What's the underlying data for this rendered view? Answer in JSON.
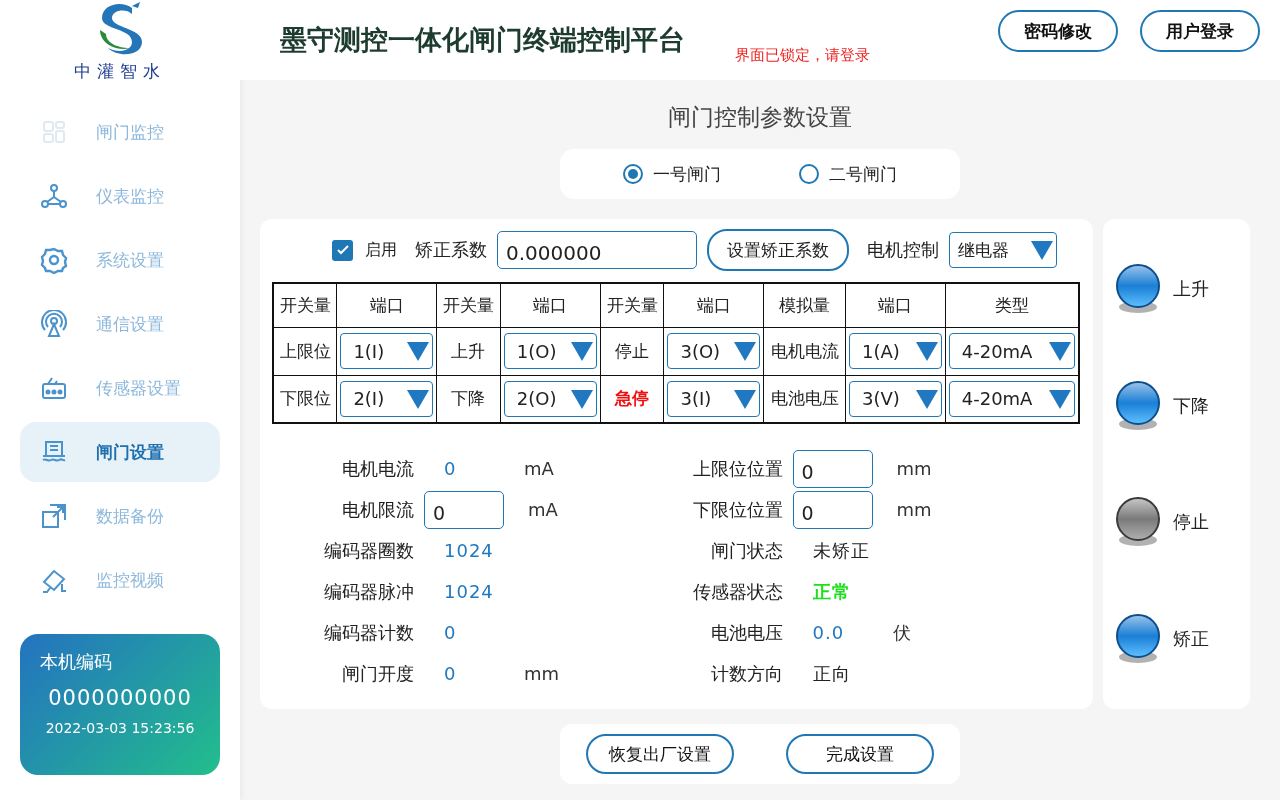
{
  "logo": {
    "text": "中灌智水"
  },
  "sidebar": {
    "items": [
      {
        "label": "闸门监控",
        "selected": false
      },
      {
        "label": "仪表监控",
        "selected": false
      },
      {
        "label": "系统设置",
        "selected": false
      },
      {
        "label": "通信设置",
        "selected": false
      },
      {
        "label": "传感器设置",
        "selected": false
      },
      {
        "label": "闸门设置",
        "selected": true
      },
      {
        "label": "数据备份",
        "selected": false
      },
      {
        "label": "监控视频",
        "selected": false
      }
    ],
    "device_card": {
      "title": "本机编码",
      "code": "0000000000",
      "datetime": "2022-03-03 15:23:56"
    }
  },
  "header": {
    "title": "墨守测控一体化闸门终端控制平台",
    "notice": "界面已锁定，请登录",
    "buttons": [
      "密码修改",
      "用户登录"
    ]
  },
  "page_title": "闸门控制参数设置",
  "gates": [
    {
      "label": "一号闸门",
      "selected": true
    },
    {
      "label": "二号闸门",
      "selected": false
    }
  ],
  "toolbar": {
    "enable": {
      "label": "启用",
      "checked": true
    },
    "coef_label": "矫正系数",
    "coef_value": "0.000000",
    "set_button": "设置矫正系数",
    "motor_label": "电机控制",
    "motor_value": "继电器"
  },
  "table": {
    "columns": [
      "开关量",
      "端口",
      "开关量",
      "端口",
      "开关量",
      "端口",
      "模拟量",
      "端口",
      "类型"
    ],
    "rows": [
      [
        {
          "kind": "label",
          "text": "上限位"
        },
        {
          "kind": "select",
          "value": "1(I)"
        },
        {
          "kind": "label",
          "text": "上升"
        },
        {
          "kind": "select",
          "value": "1(O)"
        },
        {
          "kind": "label",
          "text": "停止"
        },
        {
          "kind": "select",
          "value": "3(O)"
        },
        {
          "kind": "label",
          "text": "电机电流"
        },
        {
          "kind": "select",
          "value": "1(A)"
        },
        {
          "kind": "select",
          "value": "4-20mA"
        }
      ],
      [
        {
          "kind": "label",
          "text": "下限位"
        },
        {
          "kind": "select",
          "value": "2(I)"
        },
        {
          "kind": "label",
          "text": "下降"
        },
        {
          "kind": "select",
          "value": "2(O)"
        },
        {
          "kind": "alarm",
          "text": "急停"
        },
        {
          "kind": "select",
          "value": "3(I)"
        },
        {
          "kind": "label",
          "text": "电池电压"
        },
        {
          "kind": "select",
          "value": "3(V)"
        },
        {
          "kind": "select",
          "value": "4-20mA"
        }
      ]
    ]
  },
  "info_left": [
    {
      "label": "电机电流",
      "kind": "value",
      "value": "0",
      "color": "#1f78c0",
      "unit": "mA"
    },
    {
      "label": "电机限流",
      "kind": "field",
      "value": "0",
      "unit": "mA"
    },
    {
      "label": "编码器圈数",
      "kind": "value",
      "value": "1024",
      "color": "#1f78c0"
    },
    {
      "label": "编码器脉冲",
      "kind": "value",
      "value": "1024",
      "color": "#1f78c0"
    },
    {
      "label": "编码器计数",
      "kind": "value",
      "value": "0",
      "color": "#1f78c0"
    },
    {
      "label": "闸门开度",
      "kind": "value",
      "value": "0",
      "color": "#1f78c0",
      "unit": "mm"
    }
  ],
  "info_right": [
    {
      "label": "上限位位置",
      "kind": "field",
      "value": "0",
      "unit": "mm"
    },
    {
      "label": "下限位位置",
      "kind": "field",
      "value": "0",
      "unit": "mm"
    },
    {
      "label": "闸门状态",
      "kind": "value",
      "value": "未矫正",
      "color": "#222222"
    },
    {
      "label": "传感器状态",
      "kind": "status",
      "value": "正常",
      "color": "#1de01d"
    },
    {
      "label": "电池电压",
      "kind": "value",
      "value": "0.0",
      "color": "#1f78c0",
      "unit": "伏"
    },
    {
      "label": "计数方向",
      "kind": "value",
      "value": "正向",
      "color": "#222222"
    }
  ],
  "lamps": [
    {
      "label": "上升",
      "on": true
    },
    {
      "label": "下降",
      "on": true
    },
    {
      "label": "停止",
      "on": false
    },
    {
      "label": "矫正",
      "on": true
    }
  ],
  "footer_buttons": [
    "恢复出厂设置",
    "完成设置"
  ]
}
